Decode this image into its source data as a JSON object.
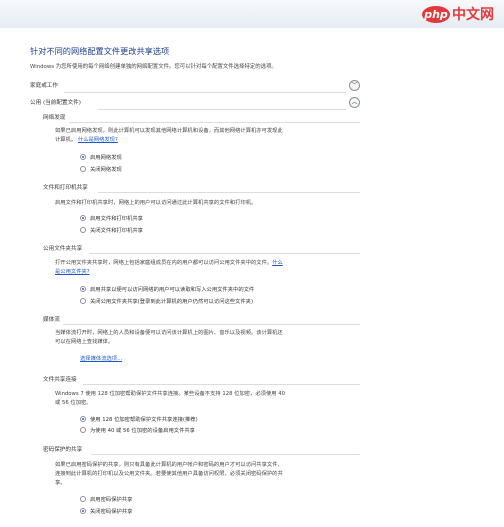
{
  "watermark": {
    "badge": "php",
    "text": "中文网"
  },
  "page": {
    "title": "针对不同的网络配置文件更改共享选项",
    "subtitle": "Windows 为您所使用的每个网络创建单独的网络配置文件。您可以针对每个配置文件选择特定的选项。"
  },
  "profiles": {
    "home_work": {
      "label": "家庭或工作",
      "chevron": "﹀"
    },
    "public": {
      "label": "公用 (当前配置文件)",
      "chevron": "︿"
    }
  },
  "sections": {
    "network_discovery": {
      "heading": "网络发现",
      "desc_1": "如果已启用网络发现，则此计算机可以发现其他网络计算机和设备，而其他网络计算机亦可发现此",
      "desc_2": "计算机。",
      "link": "什么是网络发现?",
      "options": [
        "启用网络发现",
        "关闭网络发现"
      ]
    },
    "file_printer": {
      "heading": "文件和打印机共享",
      "desc": "启用文件和打印机共享时，网络上的用户可以访问通过此计算机共享的文件和打印机。",
      "options": [
        "启用文件和打印机共享",
        "关闭文件和打印机共享"
      ]
    },
    "public_folder": {
      "heading": "公用文件夹共享",
      "desc_1": "打开公用文件夹共享时，网络上包括家庭组成员在内的用户都可以访问公用文件夹中的文件。",
      "link_1": "什么",
      "link_2": "是公用文件夹?",
      "options": [
        "启用共享以便可以访问网络的用户可以读取和写入公用文件夹中的文件",
        "关闭公用文件夹共享(登录到此计算机的用户仍然可以访问这些文件夹)"
      ]
    },
    "media": {
      "heading": "媒体流",
      "desc_1": "当媒体流打开时，网络上的人员和设备便可以访问该计算机上的图片、音乐以及视频。该计算机还",
      "desc_2": "可以在网络上查找媒体。",
      "link": "选择媒体流选项..."
    },
    "file_sharing_conn": {
      "heading": "文件共享连接",
      "desc_1": "Windows 7 使用 128 位加密帮助保护文件共享连接。某些设备不支持 128 位加密，必须使用 40",
      "desc_2": "或 56 位加密。",
      "options": [
        "使用 128 位加密帮助保护文件共享连接(推荐)",
        "为使用 40 或 56 位加密的设备启用文件共享"
      ]
    },
    "password": {
      "heading": "密码保护的共享",
      "desc_1": "如果已启用密码保护的共享，则只有具备此计算机的用户帐户和密码的用户才可以访问共享文件、",
      "desc_2": "连接到此计算机的打印机以及公用文件夹。若要使其他用户具备访问权限，必须关闭密码保护的共",
      "desc_3": "享。",
      "options": [
        "启用密码保护共享",
        "关闭密码保护共享"
      ]
    }
  }
}
